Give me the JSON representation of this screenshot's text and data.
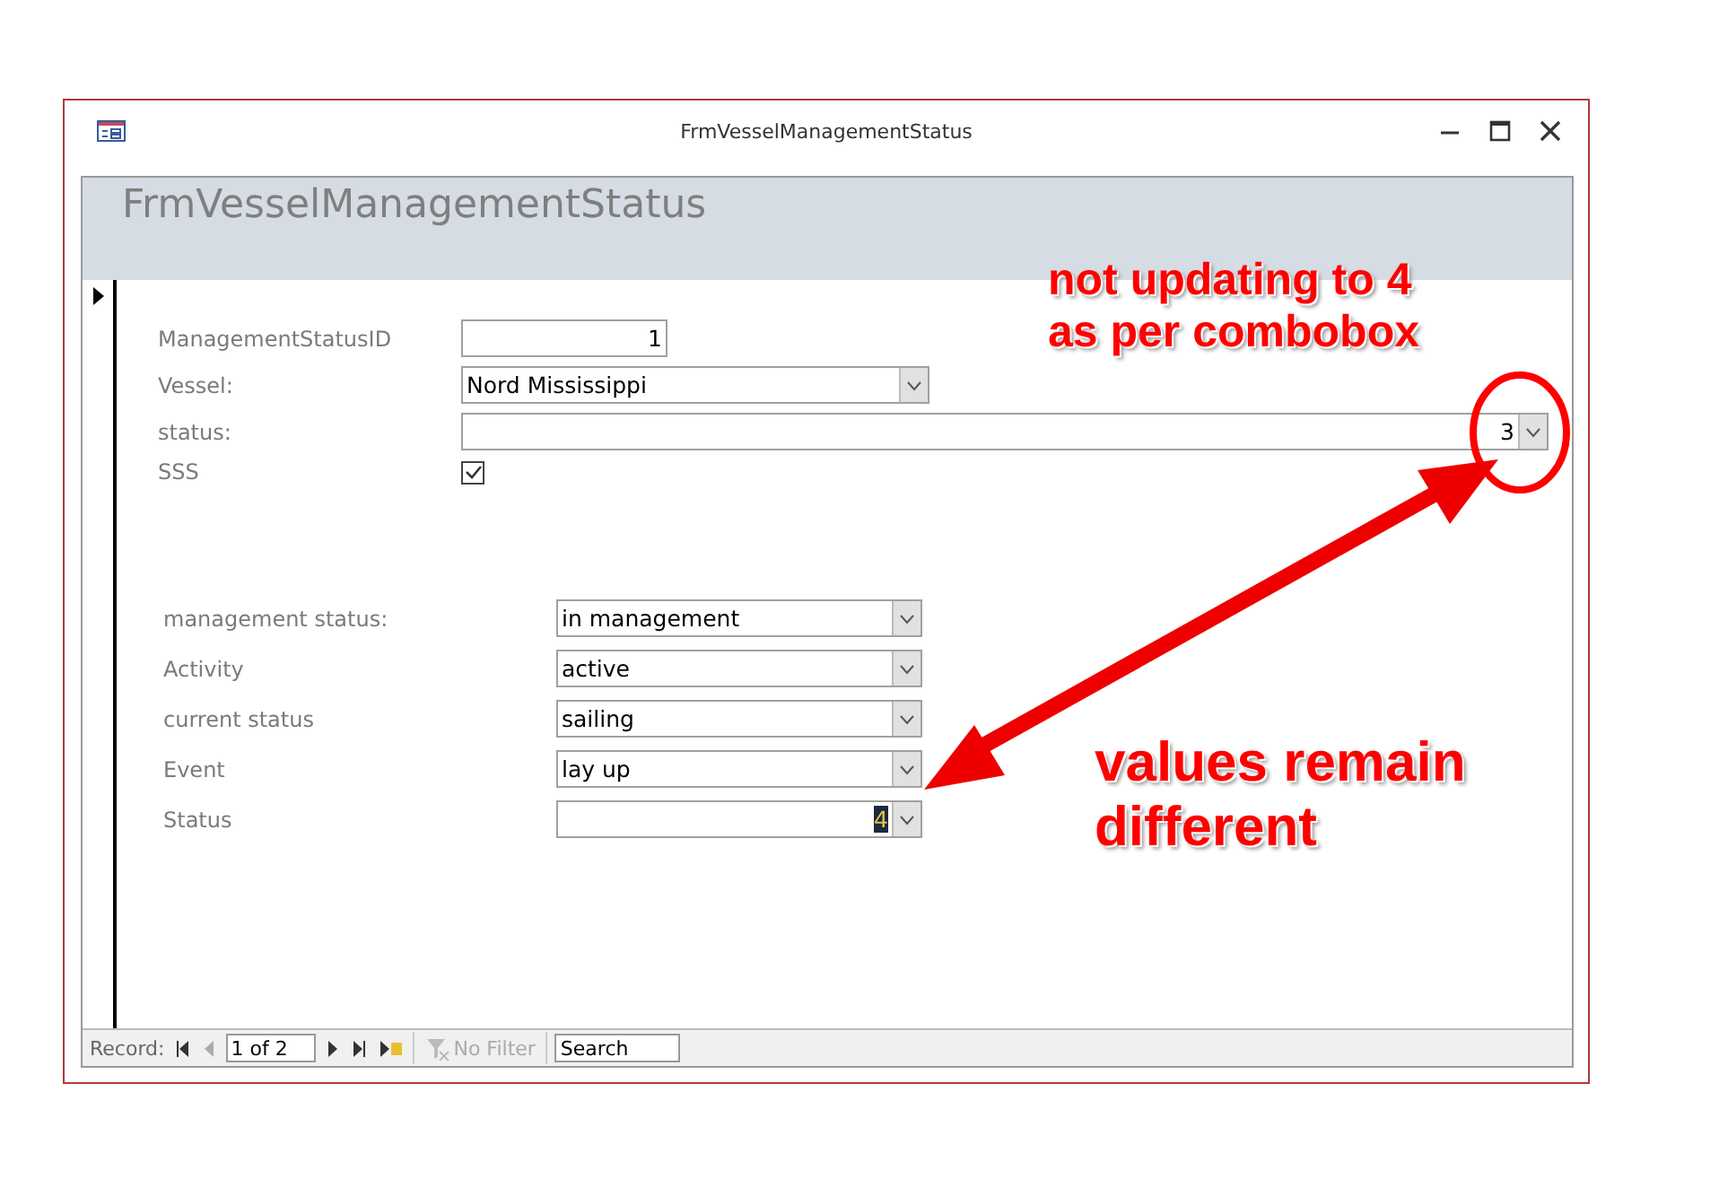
{
  "window": {
    "title": "FrmVesselManagementStatus"
  },
  "form": {
    "header": "FrmVesselManagementStatus",
    "fields": [
      {
        "label": "ManagementStatusID",
        "kind": "number",
        "value": "1"
      },
      {
        "label": "Vessel:",
        "kind": "combo",
        "value": "Nord Mississippi"
      },
      {
        "label": "status:",
        "kind": "combo_right",
        "value": "3"
      },
      {
        "label": "SSS",
        "kind": "checkbox",
        "checked": true
      }
    ],
    "fields_2": [
      {
        "label": "management status:",
        "kind": "combo",
        "value": "in management"
      },
      {
        "label": "Activity",
        "kind": "combo",
        "value": "active"
      },
      {
        "label": "current status",
        "kind": "combo",
        "value": "sailing"
      },
      {
        "label": "Event",
        "kind": "combo",
        "value": "lay up"
      },
      {
        "label": "Status",
        "kind": "combo_right",
        "value": "4",
        "highlighted": true
      }
    ]
  },
  "navigation": {
    "label": "Record:",
    "position": "1 of 2",
    "filter": "No Filter",
    "filter_disabled": true,
    "search": {
      "placeholder": "Search"
    }
  },
  "annotations": [
    {
      "text": "not updating to 4\nas per combobox"
    },
    {
      "text": "values remain\ndifferent"
    }
  ]
}
